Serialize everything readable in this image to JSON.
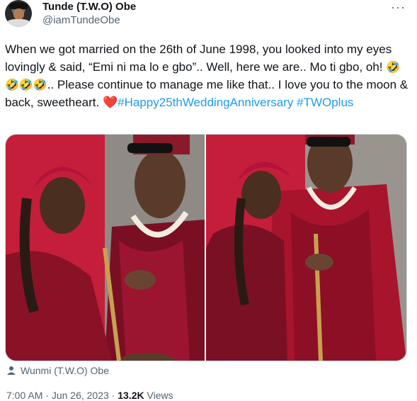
{
  "author": {
    "name": "Tunde (T.W.O) Obe",
    "handle": "@iamTundeObe"
  },
  "tweet": {
    "line1": "When we got married on the 26th of June 1998, you looked into my eyes lovingly & said, “Emi ni ma lo e gbo”.. Well, here we are.. Mo ti gbo, oh! ",
    "emoji_laugh": "🤣",
    "emoji_laugh3": "🤣🤣🤣",
    "line2": ".. Please continue to manage me like that.. I love you to the moon & back, sweetheart. ",
    "heart": "❤️",
    "hashtag1": "#Happy25thWeddingAnniversary",
    "hashtag2": "#TWOplus"
  },
  "tagged_user": "Wunmi (T.W.O) Obe",
  "meta": {
    "time": "7:00 AM",
    "date": "Jun 26, 2023",
    "views_count": "13.2K",
    "views_label": "Views"
  },
  "icons": {
    "more": "more-horizontal-icon",
    "tag": "person-icon"
  }
}
